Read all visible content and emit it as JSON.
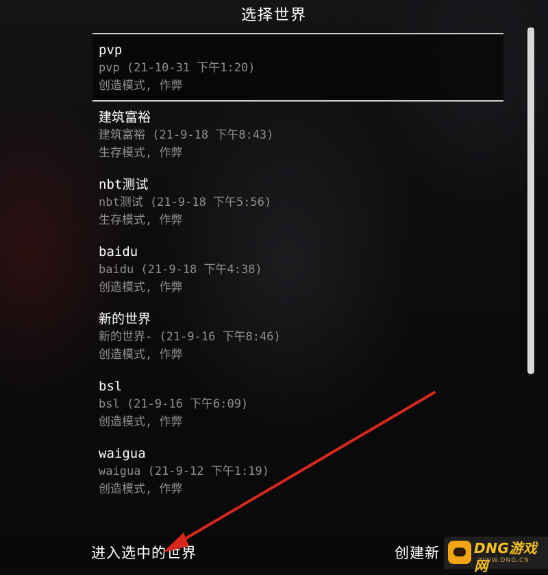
{
  "screen": {
    "title": "选择世界"
  },
  "worlds": [
    {
      "name": "pvp",
      "info": "pvp (21-10-31 下午1:20)",
      "mode": "创造模式, 作弊"
    },
    {
      "name": "建筑富裕",
      "info": "建筑富裕 (21-9-18 下午8:43)",
      "mode": "生存模式, 作弊"
    },
    {
      "name": "nbt测试",
      "info": "nbt测试 (21-9-18 下午5:56)",
      "mode": "生存模式, 作弊"
    },
    {
      "name": "baidu",
      "info": "baidu (21-9-18 下午4:38)",
      "mode": "创造模式, 作弊"
    },
    {
      "name": "新的世界",
      "info": "新的世界- (21-9-16 下午8:46)",
      "mode": "创造模式, 作弊"
    },
    {
      "name": "bsl",
      "info": "bsl (21-9-16 下午6:09)",
      "mode": "创造模式, 作弊"
    },
    {
      "name": "waigua",
      "info": "waigua (21-9-12 下午1:19)",
      "mode": "创造模式, 作弊"
    }
  ],
  "buttons": {
    "play_selected": "进入选中的世界",
    "create_new": "创建新"
  },
  "watermark": {
    "text": "DNG游戏网",
    "sub": "WWW.DNG.CN"
  },
  "annotation": {
    "color": "#d8281e"
  }
}
